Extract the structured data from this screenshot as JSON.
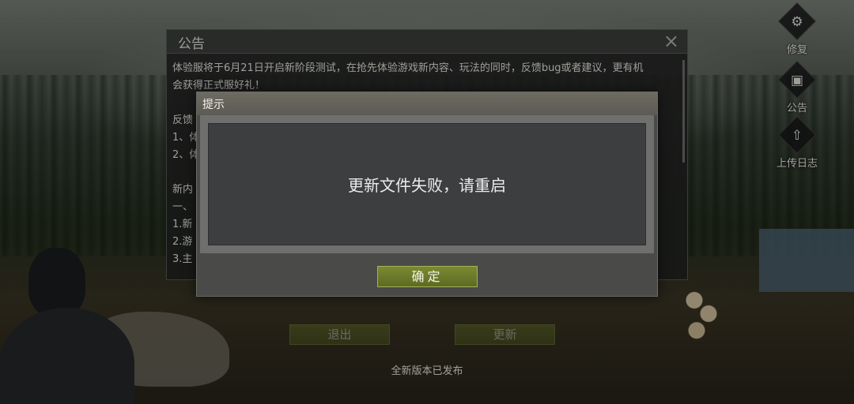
{
  "notice": {
    "title": "公告",
    "close_glyph": "×",
    "lines": [
      "体验服将于6月21日开启新阶段测试，在抢先体验游戏新内容、玩法的同时，反馈bug或者建议，更有机",
      "会获得正式服好礼！",
      "",
      "反馈",
      "1、体",
      "2、体",
      "",
      "新内",
      "一、",
      "1.新",
      "2.游",
      "3.主"
    ]
  },
  "side_menu": [
    {
      "label": "修复",
      "icon": "gear-icon",
      "glyph": "⚙"
    },
    {
      "label": "公告",
      "icon": "clipboard-icon",
      "glyph": "▣"
    },
    {
      "label": "上传日志",
      "icon": "upload-icon",
      "glyph": "⇧"
    }
  ],
  "buttons": {
    "exit_label": "退出",
    "update_label": "更新"
  },
  "release_text": "全新版本已发布",
  "alert": {
    "title": "提示",
    "message": "更新文件失败，请重启",
    "ok_label": "确定"
  },
  "colors": {
    "button_green": "#6c7a2e",
    "dialog_bg": "#4a4a48"
  }
}
